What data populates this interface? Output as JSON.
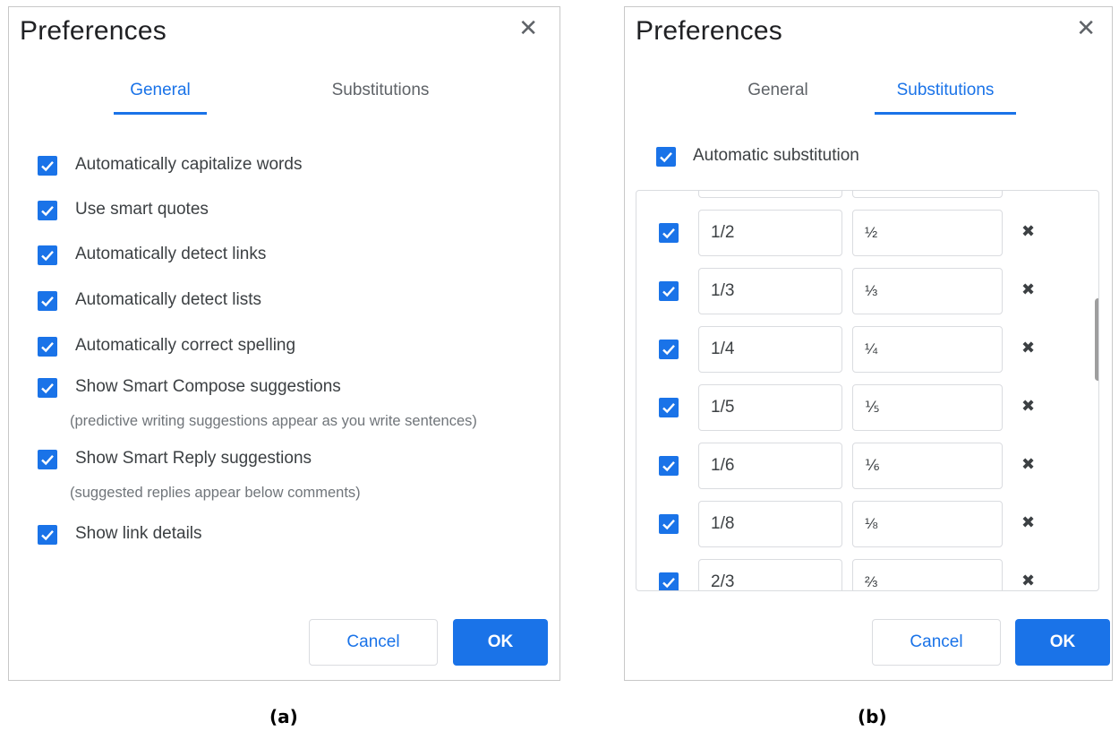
{
  "panel_a": {
    "title": "Preferences",
    "tabs": [
      "General",
      "Substitutions"
    ],
    "active_tab": "General",
    "options": [
      {
        "label": "Automatically capitalize words",
        "checked": true
      },
      {
        "label": "Use smart quotes",
        "checked": true
      },
      {
        "label": "Automatically detect links",
        "checked": true
      },
      {
        "label": "Automatically detect lists",
        "checked": true
      },
      {
        "label": "Automatically correct spelling",
        "checked": true
      },
      {
        "label": "Show Smart Compose suggestions",
        "checked": true,
        "sub": "(predictive writing suggestions appear as you write sentences)"
      },
      {
        "label": "Show Smart Reply suggestions",
        "checked": true,
        "sub": "(suggested replies appear below comments)"
      },
      {
        "label": "Show link details",
        "checked": true
      }
    ],
    "cancel_label": "Cancel",
    "ok_label": "OK",
    "caption": "(a)"
  },
  "panel_b": {
    "title": "Preferences",
    "tabs": [
      "General",
      "Substitutions"
    ],
    "active_tab": "Substitutions",
    "auto_sub_label": "Automatic substitution",
    "auto_sub_checked": true,
    "rows": [
      {
        "replace": "1/2",
        "with": "½",
        "checked": true
      },
      {
        "replace": "1/3",
        "with": "⅓",
        "checked": true
      },
      {
        "replace": "1/4",
        "with": "¼",
        "checked": true
      },
      {
        "replace": "1/5",
        "with": "⅕",
        "checked": true
      },
      {
        "replace": "1/6",
        "with": "⅙",
        "checked": true
      },
      {
        "replace": "1/8",
        "with": "⅛",
        "checked": true
      },
      {
        "replace": "2/3",
        "with": "⅔",
        "checked": true
      }
    ],
    "cancel_label": "Cancel",
    "ok_label": "OK",
    "caption": "(b)"
  },
  "colors": {
    "accent": "#1a73e8",
    "text": "#3c4043",
    "muted": "#70757a",
    "border": "#dadce0"
  },
  "icons": {
    "close": "close-icon",
    "checkbox": "check-icon",
    "delete": "delete-icon"
  }
}
